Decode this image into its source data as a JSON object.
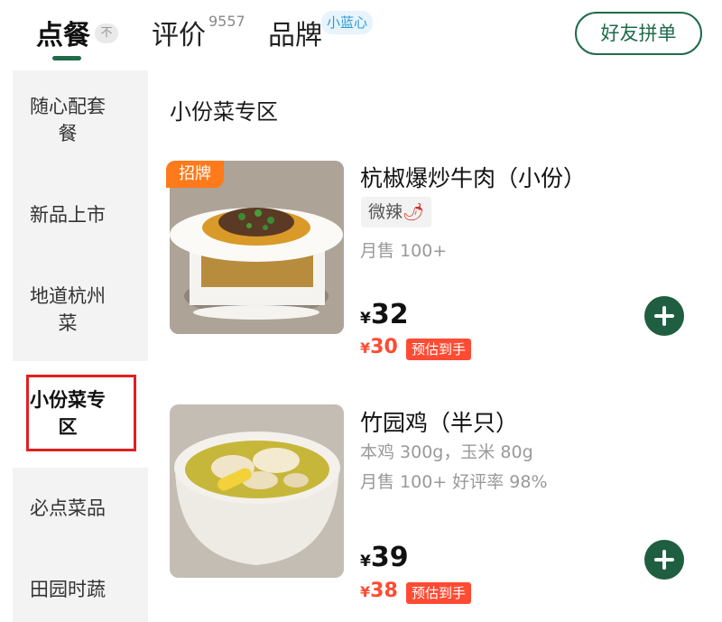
{
  "header": {
    "tabs": [
      {
        "label": "点餐",
        "badge": "不"
      },
      {
        "label": "评价",
        "count": "9557"
      },
      {
        "label": "品牌",
        "badge": "小蓝心"
      }
    ],
    "friend_button": "好友拼单"
  },
  "sidebar": {
    "items": [
      {
        "label": "随心配套餐"
      },
      {
        "label": "新品上市"
      },
      {
        "label": "地道杭州菜"
      },
      {
        "label": "小份菜专区"
      },
      {
        "label": "必点菜品"
      },
      {
        "label": "田园时蔬"
      }
    ],
    "active_index": 3
  },
  "main": {
    "section_title": "小份菜专区",
    "dishes": [
      {
        "name": "杭椒爆炒牛肉（小份）",
        "tag": "招牌",
        "spicy_label": "微辣",
        "spicy_icon": "🌶",
        "sales": "月售 100+",
        "price_symbol": "¥",
        "price": "32",
        "est_symbol": "¥",
        "est_price": "30",
        "est_label": "预估到手"
      },
      {
        "name": "竹园鸡（半只）",
        "spec": "本鸡 300g，玉米 80g",
        "sales": "月售 100+ 好评率 98%",
        "price_symbol": "¥",
        "price": "39",
        "est_symbol": "¥",
        "est_price": "38",
        "est_label": "预估到手"
      }
    ]
  },
  "colors": {
    "brand_green": "#1f6b4a",
    "accent_red": "#ff4b33",
    "tag_orange": "#ff7a1a",
    "highlight_red": "#e02020"
  }
}
